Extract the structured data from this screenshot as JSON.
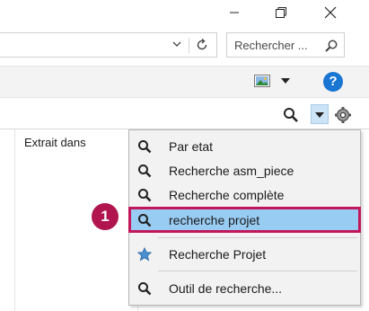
{
  "window": {
    "minimize_icon": "minimize-icon",
    "maximize_icon": "restore-icon",
    "close_icon": "close-icon"
  },
  "address_bar": {
    "dropdown_icon": "chevron-down-icon",
    "refresh_icon": "refresh-icon"
  },
  "search": {
    "placeholder": "Rechercher ...",
    "icon": "search-icon"
  },
  "toolbar": {
    "preview_icon": "image-icon",
    "help_label": "?"
  },
  "column_header": "Extrait dans",
  "menu": {
    "items": [
      {
        "label": "Par etat",
        "icon": "search-icon"
      },
      {
        "label": "Recherche asm_piece",
        "icon": "search-icon"
      },
      {
        "label": "Recherche complète",
        "icon": "search-icon"
      },
      {
        "label": "recherche projet",
        "icon": "search-icon",
        "highlighted": true
      },
      {
        "label": "Recherche Projet",
        "icon": "star-icon"
      },
      {
        "label": "Outil de recherche...",
        "icon": "search-icon"
      }
    ]
  },
  "callout": "1",
  "colors": {
    "highlight": "#99ccf3",
    "callout_border": "#c2185b",
    "callout_badge": "#b0154f",
    "help_blue": "#1976d2"
  }
}
